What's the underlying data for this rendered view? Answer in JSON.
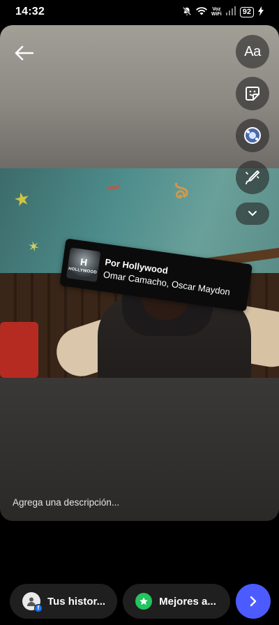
{
  "status_bar": {
    "time": "14:32",
    "network_label": "Voz\nWiFi",
    "battery": "92",
    "icons": [
      "mute-icon",
      "wifi-icon",
      "signal-icon",
      "battery-icon",
      "charging-icon"
    ]
  },
  "editor": {
    "sticker": {
      "title": "Por Hollywood",
      "artist": "Omar Camacho, Oscar Maydon",
      "album_text": "HOLLYWOOD"
    },
    "tools": {
      "text_label": "Aa",
      "icons": [
        "sticker-icon",
        "effects-icon",
        "draw-icon",
        "chevron-down-icon"
      ]
    },
    "caption_placeholder": "Agrega una descripción..."
  },
  "bottom_bar": {
    "story_label": "Tus histor...",
    "friends_label": "Mejores a...",
    "next_icon": "chevron-right-icon",
    "colors": {
      "next_button": "#4c5bff",
      "close_friends": "#22c55e",
      "facebook_badge": "#1877f2"
    }
  }
}
